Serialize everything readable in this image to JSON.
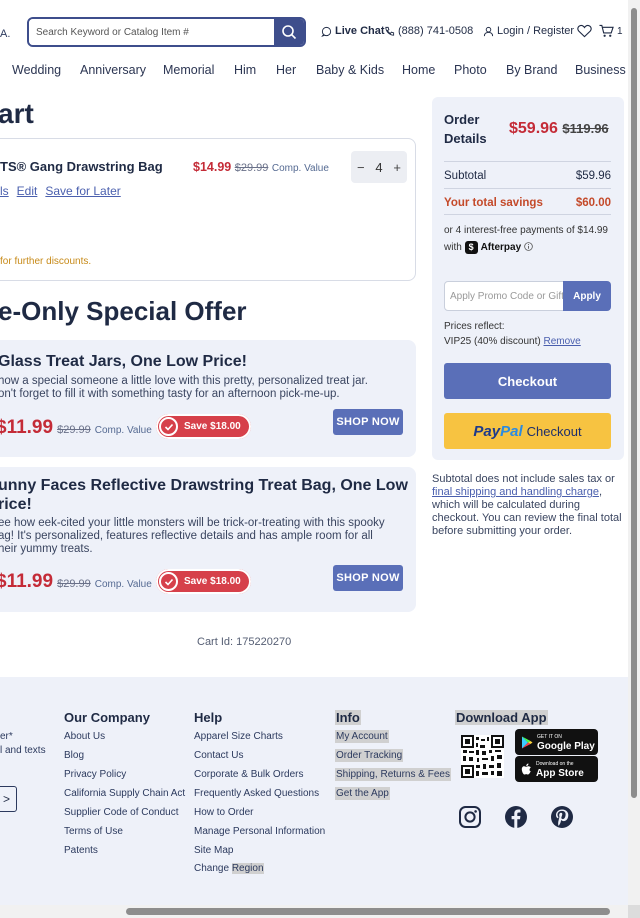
{
  "header": {
    "logo_fragment": "A.",
    "search_placeholder": "Search Keyword or Catalog Item #",
    "live_chat": "Live Chat",
    "phone": "(888) 741-0508",
    "login": "Login / Register",
    "cart_count": "1"
  },
  "nav": [
    "Wedding",
    "Anniversary",
    "Memorial",
    "Him",
    "Her",
    "Baby & Kids",
    "Home",
    "Photo",
    "By Brand",
    "Business"
  ],
  "cart": {
    "title": "art",
    "item": {
      "name": "TS® Gang Drawstring Bag",
      "price": "$14.99",
      "comp_price": "$29.99",
      "comp_label": "Comp. Value",
      "quantity": "4",
      "actions": [
        "ls",
        "Edit",
        "Save for Later"
      ]
    },
    "discount_note": "for further discounts."
  },
  "special": {
    "title": "e-Only Special Offer",
    "offers": [
      {
        "title_lines": [
          "Glass Treat Jars, One Low Price!"
        ],
        "desc_lines": [
          "how a special someone a little love with this pretty, personalized treat jar.",
          "on't forget to fill it with something tasty for an afternoon pick-me-up."
        ],
        "price": "$11.99",
        "comp_price": "$29.99",
        "comp_label": "Comp. Value",
        "save": "Save $18.00",
        "button": "SHOP NOW"
      },
      {
        "title_lines": [
          "unny Faces Reflective Drawstring Treat Bag, One Low",
          "rice!"
        ],
        "desc_lines": [
          "ee how eek-cited your little monsters will be trick-or-treating with this spooky",
          "ag! It's personalized, features reflective details and has ample room for all",
          "heir yummy treats."
        ],
        "price": "$11.99",
        "comp_price": "$29.99",
        "comp_label": "Comp. Value",
        "save": "Save $18.00",
        "button": "SHOP NOW"
      }
    ]
  },
  "cart_id": "Cart Id: 175220270",
  "summary": {
    "title_line1": "Order",
    "title_line2": "Details",
    "total": "$59.96",
    "original_total": "$119.96",
    "subtotal_label": "Subtotal",
    "subtotal": "$59.96",
    "savings_label": "Your total savings",
    "savings": "$60.00",
    "afterpay_text": "or 4 interest-free payments of $14.99",
    "afterpay_with": "with",
    "afterpay_brand": "Afterpay",
    "promo_placeholder": "Apply Promo Code or Gift C",
    "apply": "Apply",
    "prices_reflect": "Prices reflect:",
    "discount_code": "VIP25 (40% discount)",
    "remove": "Remove",
    "checkout": "Checkout",
    "paypal_pay": "Pay",
    "paypal_pal": "Pal",
    "paypal_checkout": "Checkout"
  },
  "tax_note": {
    "before": "Subtotal does not include sales tax or",
    "link": "final shipping and handling charge",
    "after": ", which will be calculated during checkout. You can review the final total before submitting your order."
  },
  "footer": {
    "frag_line1": "er*",
    "frag_line2": "l and texts",
    "frag_button": ">",
    "our_company": {
      "title": "Our Company",
      "links": [
        "About Us",
        "Blog",
        "Privacy Policy",
        "California Supply Chain Act",
        "Supplier Code of Conduct",
        "Terms of Use",
        "Patents"
      ]
    },
    "help": {
      "title": "Help",
      "links": [
        "Apparel Size Charts",
        "Contact Us",
        "Corporate & Bulk Orders",
        "Frequently Asked Questions",
        "How to Order",
        "Manage Personal Information",
        "Site Map"
      ],
      "last_link_a": "Change",
      "last_link_b": "Region"
    },
    "info": {
      "title": "Info",
      "links": [
        "My Account",
        "Order Tracking",
        "Shipping, Returns & Fees",
        "Get the App"
      ]
    },
    "download": {
      "title": "Download App",
      "google_small": "GET IT ON",
      "google_name": "Google Play",
      "apple_small": "Download on the",
      "apple_name": "App Store"
    }
  }
}
